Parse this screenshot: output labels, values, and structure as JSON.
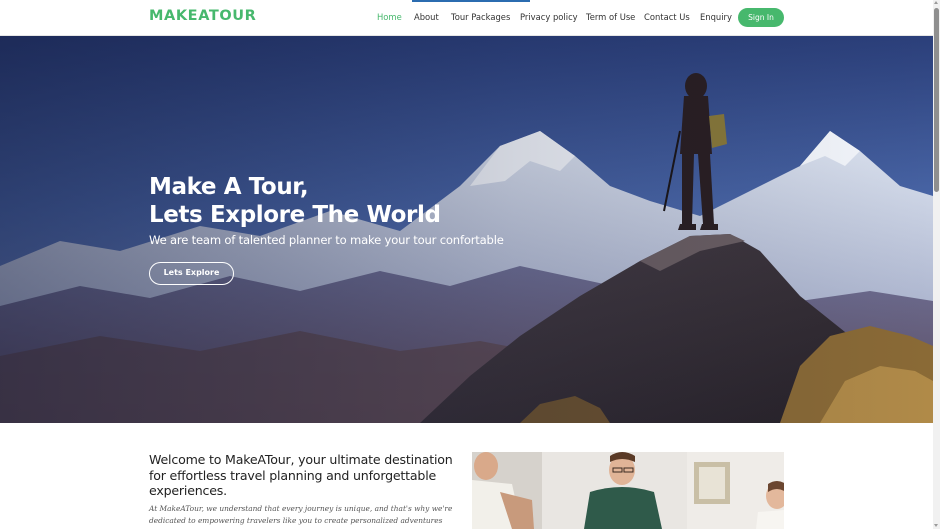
{
  "header": {
    "logo": "MAKEATOUR",
    "nav": [
      {
        "label": "Home",
        "active": true
      },
      {
        "label": "About",
        "active": false
      },
      {
        "label": "Tour Packages",
        "active": false
      },
      {
        "label": "Privacy policy",
        "active": false
      },
      {
        "label": "Term of Use",
        "active": false
      },
      {
        "label": "Contact Us",
        "active": false
      },
      {
        "label": "Enquiry",
        "active": false
      }
    ],
    "signin_label": "Sign In"
  },
  "hero": {
    "title_line1": "Make A Tour,",
    "title_line2": "Lets Explore The World",
    "subtitle": "We are team of talented planner to make your tour confortable",
    "button_label": "Lets Explore"
  },
  "welcome": {
    "title": "Welcome to MakeATour, your ultimate destination for effortless travel planning and unforgettable experiences.",
    "text": "At MakeATour, we understand that every journey is unique, and that's why we're dedicated to empowering travelers like you to create personalized adventures tailored to"
  },
  "colors": {
    "accent": "#47b86d",
    "text": "#333333",
    "header_accent": "#2b6cb0"
  }
}
